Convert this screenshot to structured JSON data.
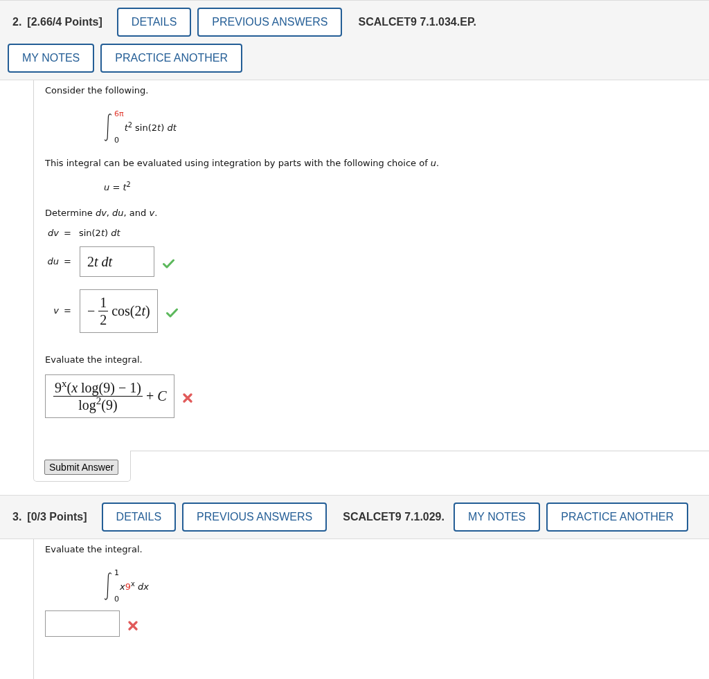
{
  "questions": [
    {
      "header": {
        "items": [
          {
            "kind": "number",
            "text": "2."
          },
          {
            "kind": "points",
            "text": "[2.66/4 Points]"
          },
          {
            "kind": "button",
            "label": "DETAILS"
          },
          {
            "kind": "button",
            "label": "PREVIOUS ANSWERS"
          },
          {
            "kind": "code",
            "text": "SCALCET9 7.1.034.EP."
          }
        ],
        "actions": [
          {
            "label": "MY NOTES"
          },
          {
            "label": "PRACTICE ANOTHER"
          }
        ]
      },
      "body": [
        {
          "kind": "text",
          "text": "Consider the following."
        },
        {
          "kind": "integral",
          "upper": [
            {
              "text": "6π",
              "highlighted": true
            }
          ],
          "lower": [
            {
              "text": "0",
              "highlighted": false
            }
          ],
          "integrand": [
            {
              "text": "*t*$^{2}$ sin(2",
              "highlighted": false
            },
            {
              "text": "*t*",
              "highlighted": false
            },
            {
              "text": ") *dt*",
              "highlighted": false
            }
          ]
        },
        {
          "kind": "text",
          "text": "This integral can be evaluated using integration by parts with the following choice of *u*."
        },
        {
          "kind": "equation",
          "text": "*u* = *t*$^{2}$"
        },
        {
          "kind": "text",
          "text": "Determine *dv*, *du*, and *v*."
        },
        {
          "kind": "given",
          "label": "dv",
          "sign": "=",
          "value": [
            "sin(2",
            "*t*",
            ") *dt*"
          ]
        },
        {
          "kind": "answer",
          "label": "du",
          "sign": "=",
          "math": [
            {
              "kind": "text",
              "parts": [
                "2",
                "*t*",
                " *dt*"
              ]
            }
          ],
          "correct": true
        },
        {
          "kind": "answer",
          "label": "v",
          "sign": "=",
          "math": [
            {
              "kind": "text",
              "parts": [
                "−"
              ]
            },
            {
              "kind": "fraction",
              "numerator": "1",
              "denominator": "2"
            },
            {
              "kind": "text",
              "parts": [
                "cos(2",
                "*t*",
                ")"
              ]
            }
          ],
          "correct": true
        },
        {
          "kind": "text",
          "text": "Evaluate the integral."
        },
        {
          "kind": "answer",
          "math": [
            {
              "kind": "fraction",
              "numerator": "9$^{x}$(*x* log(9) − 1)",
              "denominator": "log$^{2}$(9)"
            },
            {
              "kind": "text",
              "parts": [
                "+ *C*"
              ]
            }
          ],
          "correct": false
        }
      ],
      "submit_button": "Submit Answer"
    },
    {
      "header": {
        "items": [
          {
            "kind": "number",
            "text": "3."
          },
          {
            "kind": "points",
            "text": "[0/3 Points]"
          },
          {
            "kind": "button",
            "label": "DETAILS"
          },
          {
            "kind": "button",
            "label": "PREVIOUS ANSWERS"
          },
          {
            "kind": "code",
            "text": "SCALCET9 7.1.029."
          }
        ],
        "actions": [
          {
            "label": "MY NOTES"
          },
          {
            "label": "PRACTICE ANOTHER"
          }
        ]
      },
      "body": [
        {
          "kind": "text",
          "text": "Evaluate the integral."
        },
        {
          "kind": "integral",
          "upper": [
            {
              "text": "1",
              "highlighted": false
            }
          ],
          "lower": [
            {
              "text": "0",
              "highlighted": false
            }
          ],
          "integrand": [
            {
              "text": "*x*",
              "highlighted": false
            },
            {
              "text": "9",
              "highlighted": true
            },
            {
              "text": "$^{x}$ *dx*",
              "highlighted": false
            }
          ]
        },
        {
          "kind": "answer",
          "correct": false
        }
      ]
    }
  ]
}
